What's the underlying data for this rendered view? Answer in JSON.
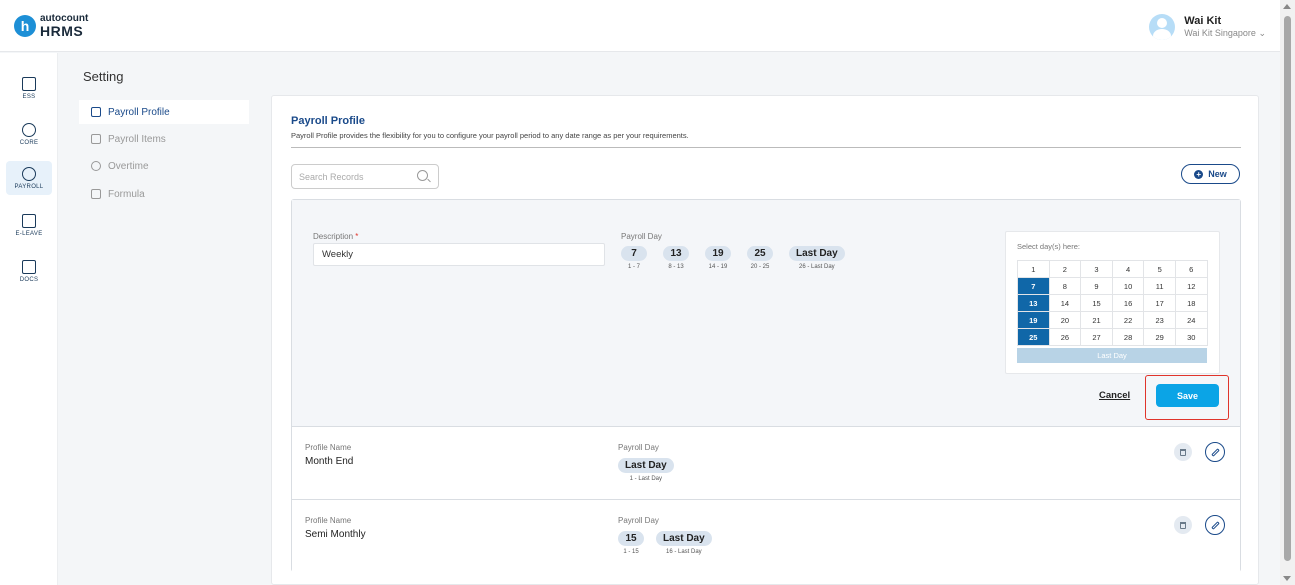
{
  "app": {
    "logo_prefix": "autocount",
    "logo_name": "HRMS"
  },
  "user": {
    "name": "Wai Kit",
    "company": "Wai Kit Singapore",
    "company_caret": "⌄"
  },
  "nav": [
    {
      "label": "ESS",
      "icon": "ess-icon"
    },
    {
      "label": "CORE",
      "icon": "core-icon"
    },
    {
      "label": "PAYROLL",
      "icon": "payroll-icon",
      "active": true
    },
    {
      "label": "E-LEAVE",
      "icon": "calendar-icon"
    },
    {
      "label": "DOCS",
      "icon": "docs-icon"
    }
  ],
  "page": {
    "title": "Setting"
  },
  "menu": [
    {
      "label": "Payroll Profile",
      "active": true
    },
    {
      "label": "Payroll Items"
    },
    {
      "label": "Overtime"
    },
    {
      "label": "Formula"
    }
  ],
  "section": {
    "title": "Payroll Profile",
    "description": "Payroll Profile provides the flexibility for you to configure your payroll period to any date range as per your requirements."
  },
  "search": {
    "placeholder": "Search Records",
    "value": ""
  },
  "new_button": {
    "label": "New"
  },
  "form": {
    "description_label": "Description",
    "required_mark": "*",
    "description_value": "Weekly",
    "payroll_day_label": "Payroll Day",
    "payroll_days": [
      {
        "day": "7",
        "range": "1 - 7"
      },
      {
        "day": "13",
        "range": "8 - 13"
      },
      {
        "day": "19",
        "range": "14 - 19"
      },
      {
        "day": "25",
        "range": "20 - 25"
      },
      {
        "day": "Last Day",
        "range": "26 - Last Day"
      }
    ],
    "picker_label": "Select day(s) here:",
    "picker_days": [
      {
        "d": "1",
        "sel": false
      },
      {
        "d": "2",
        "sel": false
      },
      {
        "d": "3",
        "sel": false
      },
      {
        "d": "4",
        "sel": false
      },
      {
        "d": "5",
        "sel": false
      },
      {
        "d": "6",
        "sel": false
      },
      {
        "d": "7",
        "sel": true
      },
      {
        "d": "8",
        "sel": false
      },
      {
        "d": "9",
        "sel": false
      },
      {
        "d": "10",
        "sel": false
      },
      {
        "d": "11",
        "sel": false
      },
      {
        "d": "12",
        "sel": false
      },
      {
        "d": "13",
        "sel": true
      },
      {
        "d": "14",
        "sel": false
      },
      {
        "d": "15",
        "sel": false
      },
      {
        "d": "16",
        "sel": false
      },
      {
        "d": "17",
        "sel": false
      },
      {
        "d": "18",
        "sel": false
      },
      {
        "d": "19",
        "sel": true
      },
      {
        "d": "20",
        "sel": false
      },
      {
        "d": "21",
        "sel": false
      },
      {
        "d": "22",
        "sel": false
      },
      {
        "d": "23",
        "sel": false
      },
      {
        "d": "24",
        "sel": false
      },
      {
        "d": "25",
        "sel": true
      },
      {
        "d": "26",
        "sel": false
      },
      {
        "d": "27",
        "sel": false
      },
      {
        "d": "28",
        "sel": false
      },
      {
        "d": "29",
        "sel": false
      },
      {
        "d": "30",
        "sel": false
      }
    ],
    "picker_last_day": "Last Day",
    "cancel_label": "Cancel",
    "save_label": "Save"
  },
  "profiles": [
    {
      "name_label": "Profile Name",
      "name": "Month End",
      "payroll_day_label": "Payroll Day",
      "days": [
        {
          "day": "Last Day",
          "range": "1 - Last Day"
        }
      ]
    },
    {
      "name_label": "Profile Name",
      "name": "Semi Monthly",
      "payroll_day_label": "Payroll Day",
      "days": [
        {
          "day": "15",
          "range": "1 - 15"
        },
        {
          "day": "Last Day",
          "range": "16 - Last Day"
        }
      ]
    }
  ],
  "colors": {
    "accent": "#1a4a8a",
    "save": "#0ba4e6",
    "selected_day": "#1067a8",
    "highlight": "#e0342b"
  }
}
